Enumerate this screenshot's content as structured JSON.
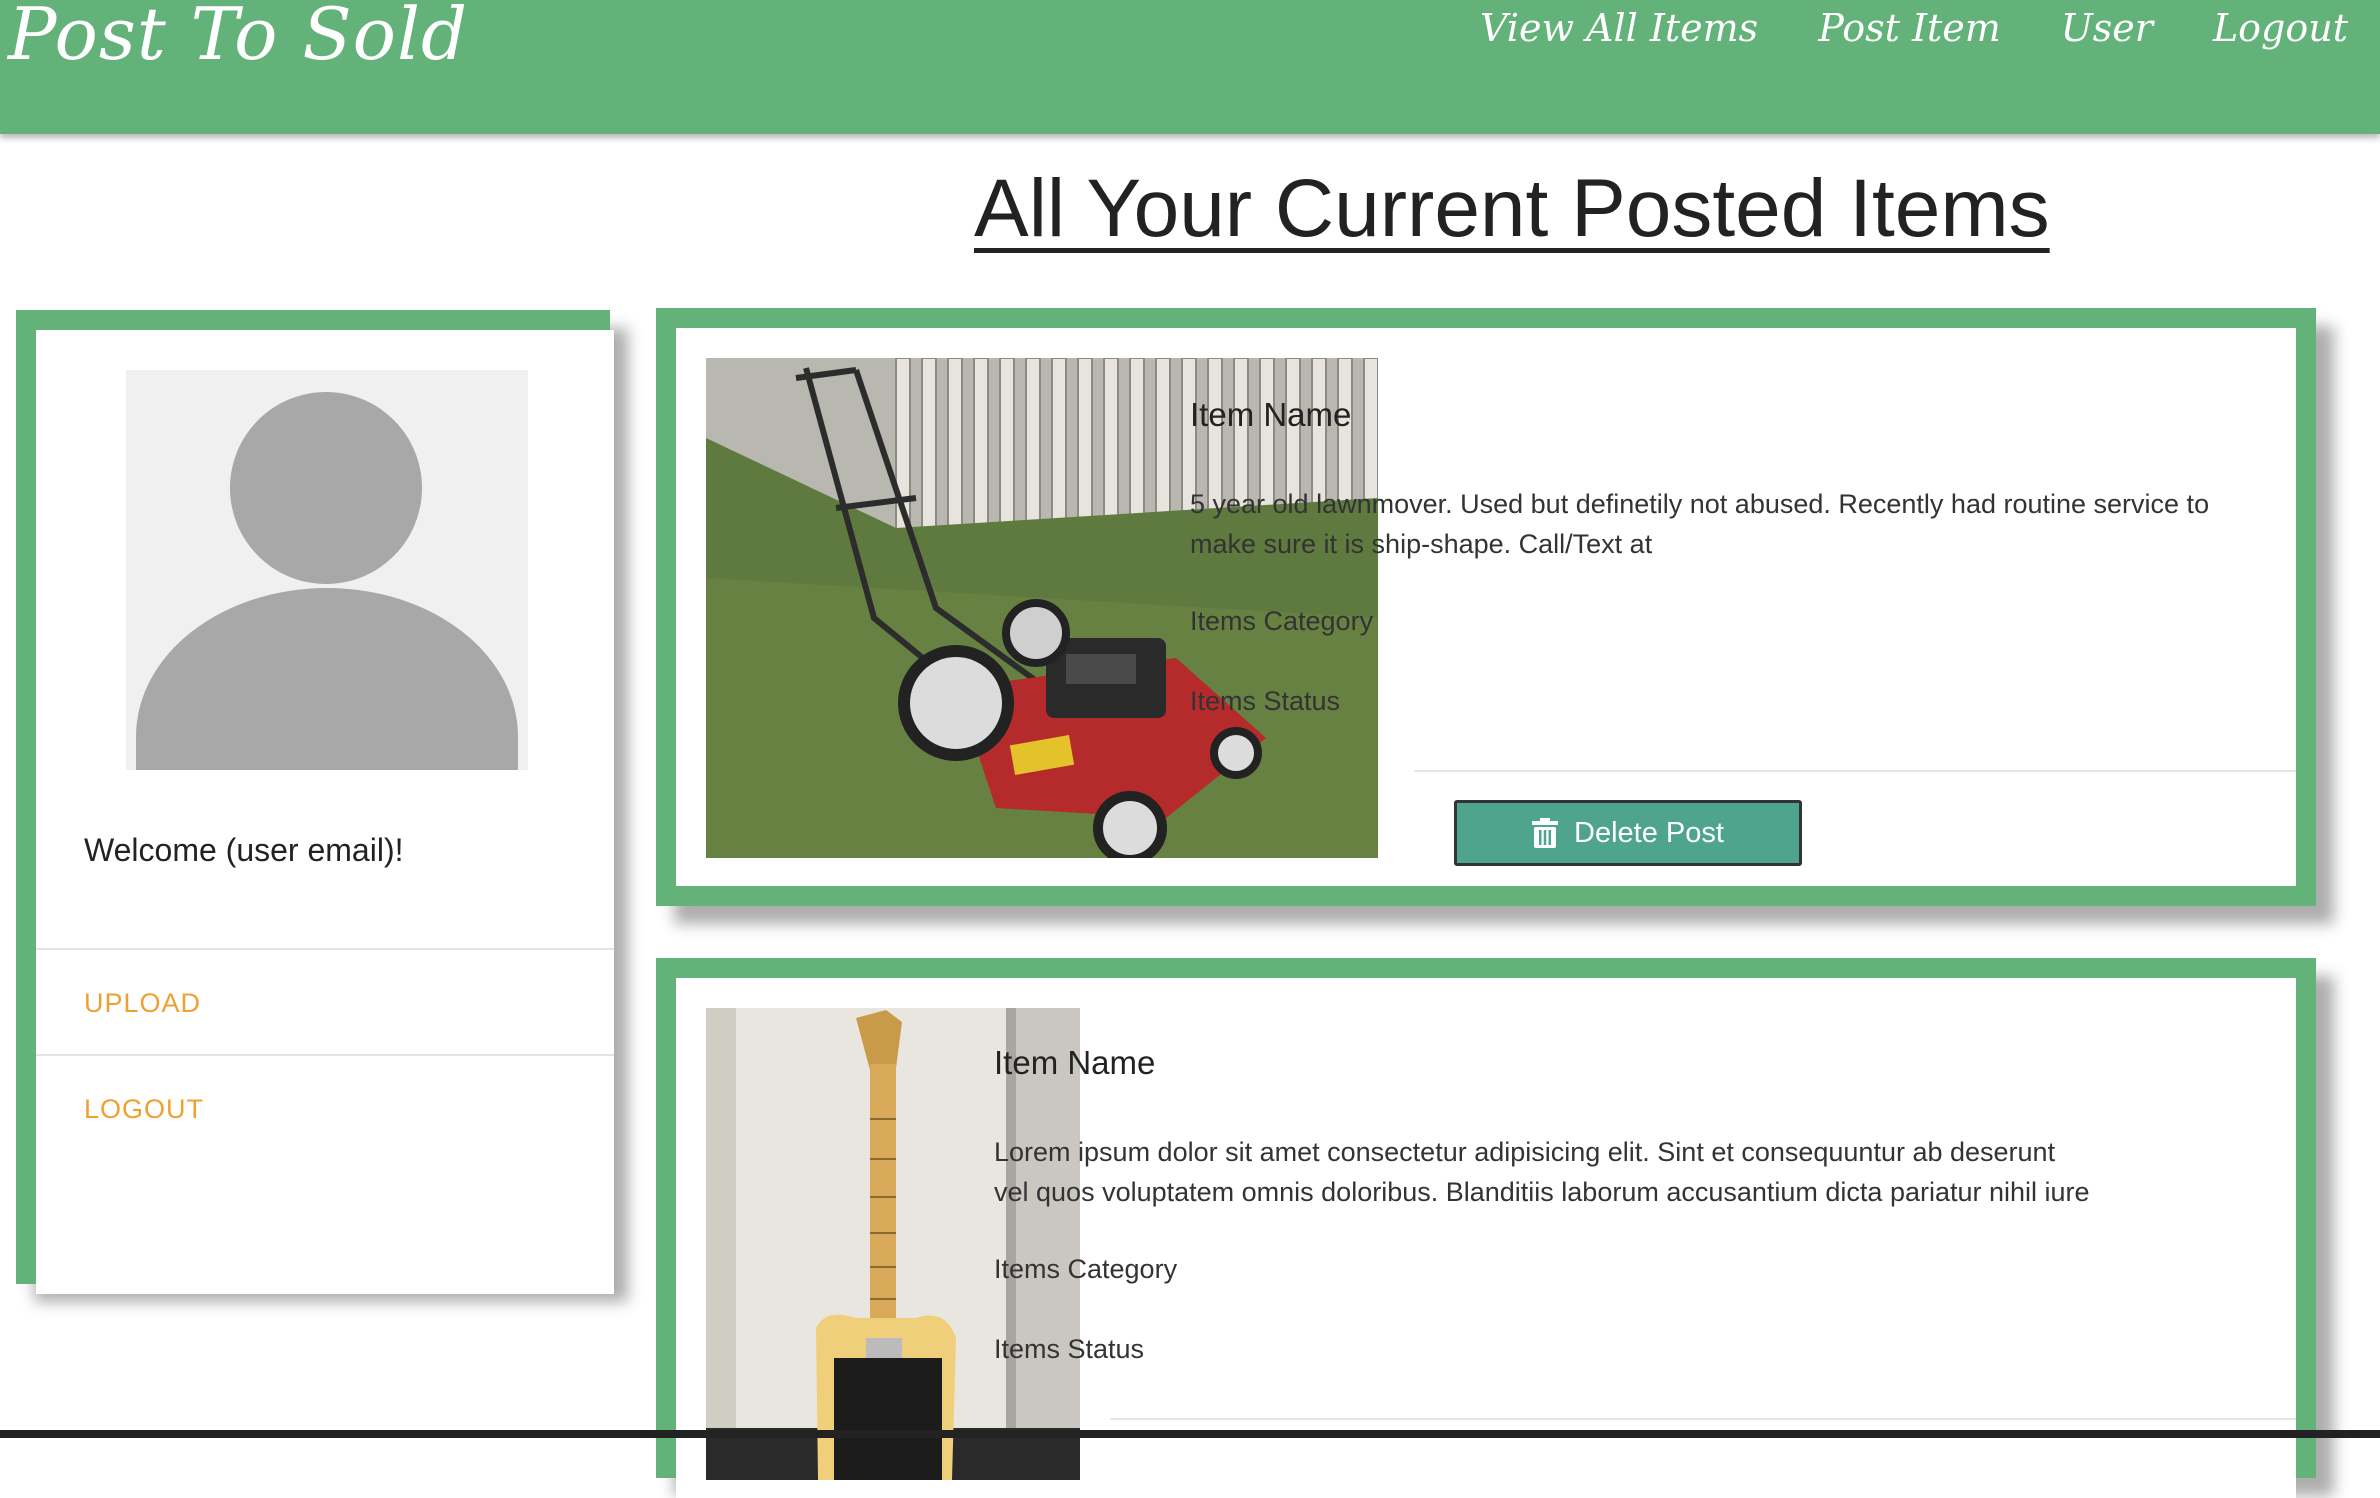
{
  "nav": {
    "brand": "Post To Sold",
    "links": [
      "View All Items",
      "Post Item",
      "User",
      "Logout"
    ]
  },
  "page": {
    "title": "All Your Current Posted Items"
  },
  "sidebar": {
    "welcome": "Welcome (user email)!",
    "links": [
      "UPLOAD",
      "LOGOUT"
    ]
  },
  "items": [
    {
      "name": "Item Name",
      "description": "5 year old lawnmover. Used but definetily not abused. Recently had routine service to make sure it is ship-shape. Call/Text at",
      "category": "Items Category",
      "status": "Items Status",
      "delete_label": "Delete Post",
      "image": "lawnmower-photo"
    },
    {
      "name": "Item Name",
      "description": "Lorem ipsum dolor sit amet consectetur adipisicing elit. Sint et consequuntur ab deserunt vel quos voluptatem omnis doloribus. Blanditiis laborum accusantium dicta pariatur nihil iure",
      "category": "Items Category",
      "status": "Items Status",
      "image": "guitar-photo"
    }
  ],
  "colors": {
    "brand_green": "#62b279",
    "button_teal": "#4fa48e",
    "link_orange": "#f0a030"
  },
  "icons": {
    "delete": "trash-icon",
    "avatar": "user-silhouette-icon"
  }
}
